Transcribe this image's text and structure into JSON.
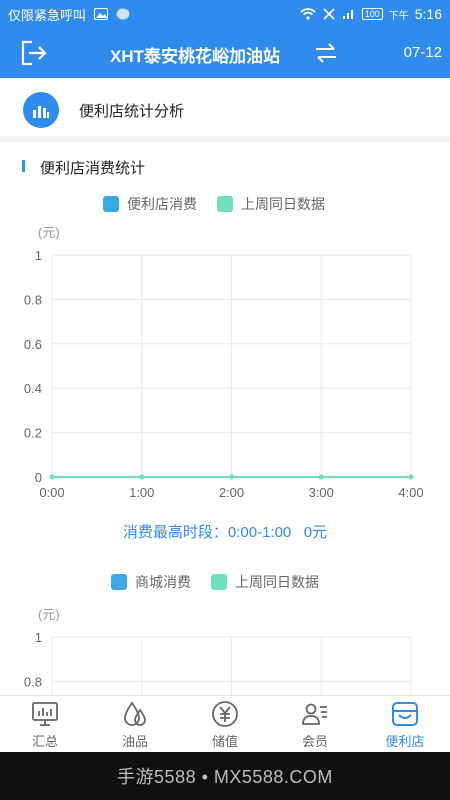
{
  "status_bar": {
    "carrier_text": "仅限紧急呼叫",
    "battery": "100",
    "time_prefix": "下午",
    "time": "5:16"
  },
  "header": {
    "title": "XHT泰安桃花峪加油站",
    "date": "07-12"
  },
  "section": {
    "title": "便利店统计分析",
    "subtitle": "便利店消费统计"
  },
  "peak": {
    "label": "消费最高时段：0:00-1:00",
    "value": "0元"
  },
  "colors": {
    "primary": "#2f8bec",
    "series_current": "#3aa8e2",
    "series_last_week": "#6ee0be"
  },
  "chart_data": [
    {
      "type": "line",
      "title": "",
      "ylabel": "(元)",
      "x": [
        "0:00",
        "1:00",
        "2:00",
        "3:00",
        "4:00"
      ],
      "ylim": [
        0,
        1
      ],
      "yticks": [
        "0",
        "0.2",
        "0.4",
        "0.6",
        "0.8",
        "1"
      ],
      "series": [
        {
          "name": "便利店消费",
          "values": [
            0,
            0,
            0,
            0,
            0
          ]
        },
        {
          "name": "上周同日数据",
          "values": [
            0,
            0,
            0,
            0,
            0
          ]
        }
      ],
      "grid": true,
      "legend": "top"
    },
    {
      "type": "line",
      "title": "",
      "ylabel": "(元)",
      "ylim": [
        0,
        1
      ],
      "yticks": [
        "0.8",
        "1"
      ],
      "series": [
        {
          "name": "商城消费"
        },
        {
          "name": "上周同日数据"
        }
      ],
      "grid": true,
      "legend": "top"
    }
  ],
  "nav": {
    "items": [
      {
        "label": "汇总",
        "icon": "monitor-icon"
      },
      {
        "label": "油品",
        "icon": "oil-drops-icon"
      },
      {
        "label": "储值",
        "icon": "yuan-coin-icon"
      },
      {
        "label": "会员",
        "icon": "member-card-icon"
      },
      {
        "label": "便利店",
        "icon": "store-icon"
      }
    ],
    "active_index": 4
  },
  "watermark": {
    "text": "手游5588 • MX5588.COM"
  }
}
